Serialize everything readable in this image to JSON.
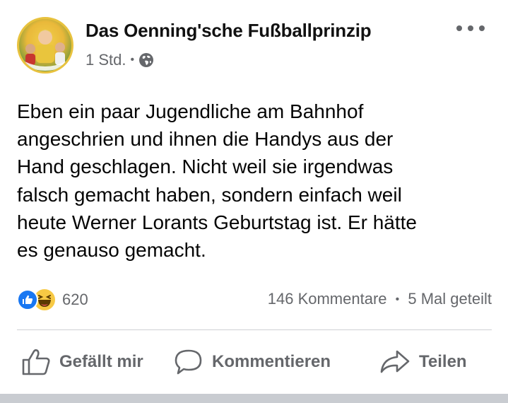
{
  "post": {
    "page_name": "Das Oenning'sche Fußballprinzip",
    "avatar_alt": "Page avatar",
    "time": "1 Std.",
    "meta_separator": "•",
    "audience_icon": "globe-icon",
    "more_icon": "more-options-icon",
    "text_lines": [
      "Eben ein paar Jugendliche am Bahnhof",
      "angeschrien und ihnen die Handys aus der",
      "Hand geschlagen. Nicht weil sie irgendwas",
      "falsch gemacht haben, sondern einfach weil",
      "heute Werner Lorants Geburtstag ist. Er hätte",
      "es genauso gemacht."
    ]
  },
  "stats": {
    "reaction_icons": [
      "like-reaction-icon",
      "haha-reaction-icon"
    ],
    "reaction_count": "620",
    "comments": "146 Kommentare",
    "separator": "•",
    "shares": "5 Mal geteilt"
  },
  "actions": {
    "like": "Gefällt mir",
    "comment": "Kommentieren",
    "share": "Teilen"
  },
  "colors": {
    "text": "#050505",
    "secondary": "#65676b",
    "like_blue": "#1877f2",
    "haha_yellow": "#f7c944",
    "divider": "#ced0d4"
  }
}
